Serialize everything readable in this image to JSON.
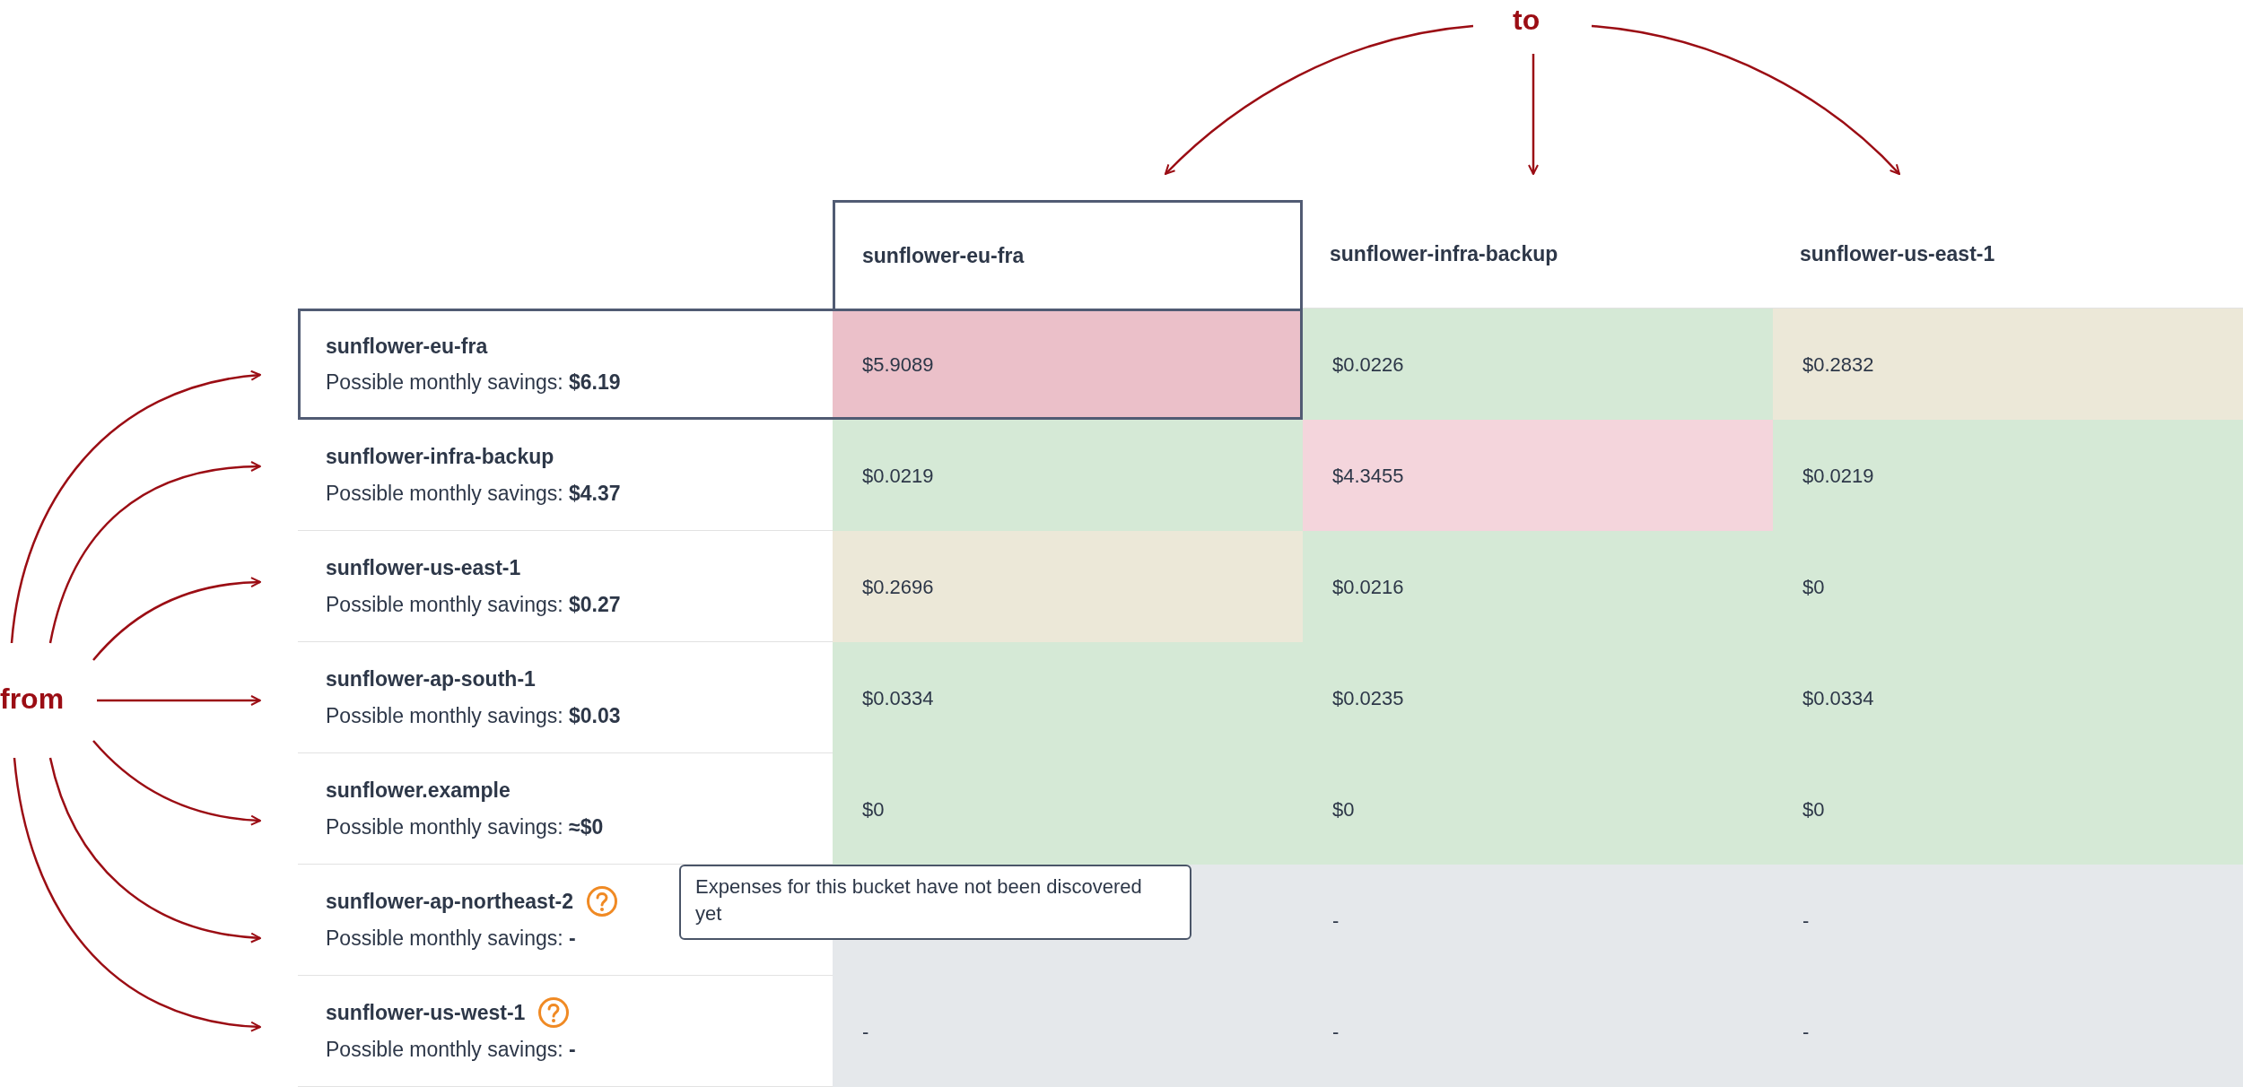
{
  "annotations": {
    "to_label": "to",
    "from_label": "from"
  },
  "columns": [
    {
      "label": "sunflower-eu-fra",
      "selected": true
    },
    {
      "label": "sunflower-infra-backup",
      "selected": false
    },
    {
      "label": "sunflower-us-east-1",
      "selected": false
    }
  ],
  "rows": [
    {
      "name": "sunflower-eu-fra",
      "savings": "Possible monthly savings: **$6.19**",
      "info_icon": false,
      "selected": true,
      "cells": [
        {
          "value": "$5.9089",
          "color": "#ebc0c9"
        },
        {
          "value": "$0.0226",
          "color": "#d5e9d6"
        },
        {
          "value": "$0.2832",
          "color": "#ece8d8"
        }
      ]
    },
    {
      "name": "sunflower-infra-backup",
      "savings": "Possible monthly savings: **$4.37**",
      "info_icon": false,
      "selected": false,
      "cells": [
        {
          "value": "$0.0219",
          "color": "#d5e9d6"
        },
        {
          "value": "$4.3455",
          "color": "#f4d5dc"
        },
        {
          "value": "$0.0219",
          "color": "#d5e9d6"
        }
      ]
    },
    {
      "name": "sunflower-us-east-1",
      "savings": "Possible monthly savings: **$0.27**",
      "info_icon": false,
      "selected": false,
      "cells": [
        {
          "value": "$0.2696",
          "color": "#ece8d8"
        },
        {
          "value": "$0.0216",
          "color": "#d5e9d6"
        },
        {
          "value": "$0",
          "color": "#d5e9d6"
        }
      ]
    },
    {
      "name": "sunflower-ap-south-1",
      "savings": "Possible monthly savings: **$0.03**",
      "info_icon": false,
      "selected": false,
      "cells": [
        {
          "value": "$0.0334",
          "color": "#d5e9d6"
        },
        {
          "value": "$0.0235",
          "color": "#d5e9d6"
        },
        {
          "value": "$0.0334",
          "color": "#d5e9d6"
        }
      ]
    },
    {
      "name": "sunflower.example",
      "savings": "Possible monthly savings: **≈$0**",
      "info_icon": false,
      "selected": false,
      "cells": [
        {
          "value": "$0",
          "color": "#d5e9d6"
        },
        {
          "value": "$0",
          "color": "#d5e9d6"
        },
        {
          "value": "$0",
          "color": "#d5e9d6"
        }
      ]
    },
    {
      "name": "sunflower-ap-northeast-2",
      "savings": "Possible monthly savings: **-**",
      "info_icon": true,
      "selected": false,
      "cells": [
        {},
        {
          "value": "-",
          "color": "#e5e8eb"
        },
        {
          "value": "-",
          "color": "#e5e8eb"
        }
      ]
    },
    {
      "name": "sunflower-us-west-1",
      "savings": "Possible monthly savings: **-**",
      "info_icon": true,
      "selected": false,
      "cells": [
        {
          "value": "-",
          "color": "#e5e8eb"
        },
        {
          "value": "-",
          "color": "#e5e8eb"
        },
        {
          "value": "-",
          "color": "#e5e8eb"
        }
      ]
    }
  ],
  "tooltip": {
    "text": "Expenses for this bucket have not been discovered yet"
  }
}
